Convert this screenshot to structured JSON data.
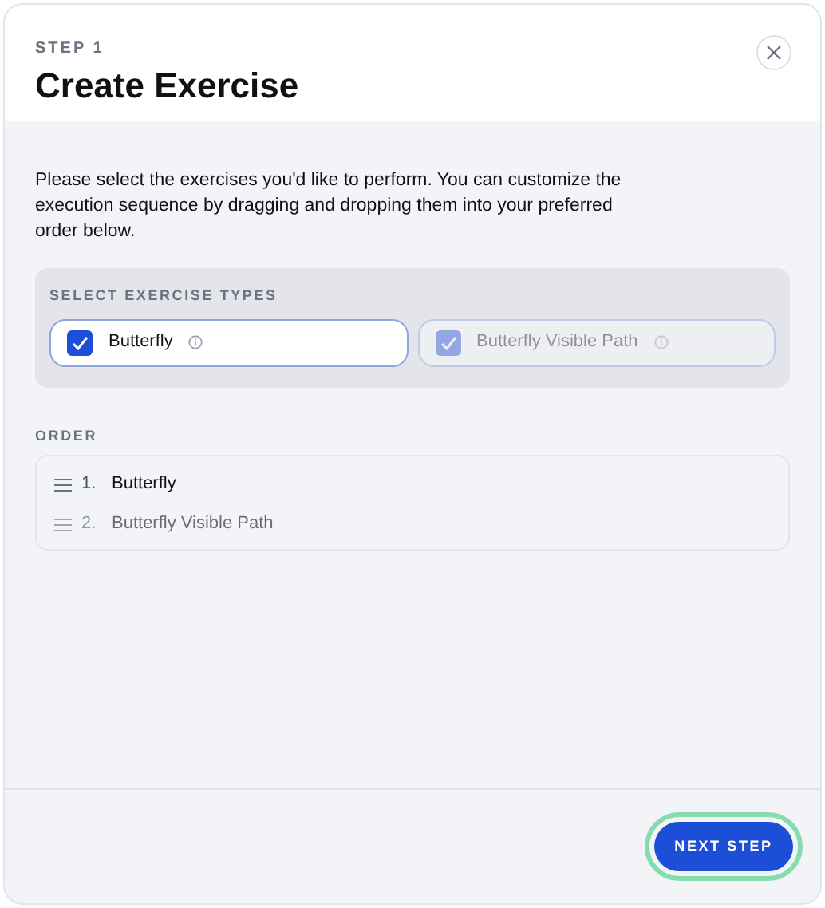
{
  "header": {
    "step": "STEP 1",
    "title": "Create Exercise"
  },
  "description": "Please select the exercises you'd like to perform. You can customize the execution sequence by dragging and dropping them into your preferred order below.",
  "exercise_types": {
    "label": "SELECT EXERCISE TYPES",
    "options": [
      {
        "label": "Butterfly",
        "checked": true,
        "blurred": false
      },
      {
        "label": "Butterfly Visible Path",
        "checked": true,
        "blurred": true
      }
    ]
  },
  "order": {
    "label": "ORDER",
    "items": [
      {
        "number": "1.",
        "label": "Butterfly",
        "blurred": false
      },
      {
        "number": "2.",
        "label": "Butterfly Visible Path",
        "blurred": true
      }
    ]
  },
  "footer": {
    "button": "NEXT STEP",
    "focused": true
  }
}
